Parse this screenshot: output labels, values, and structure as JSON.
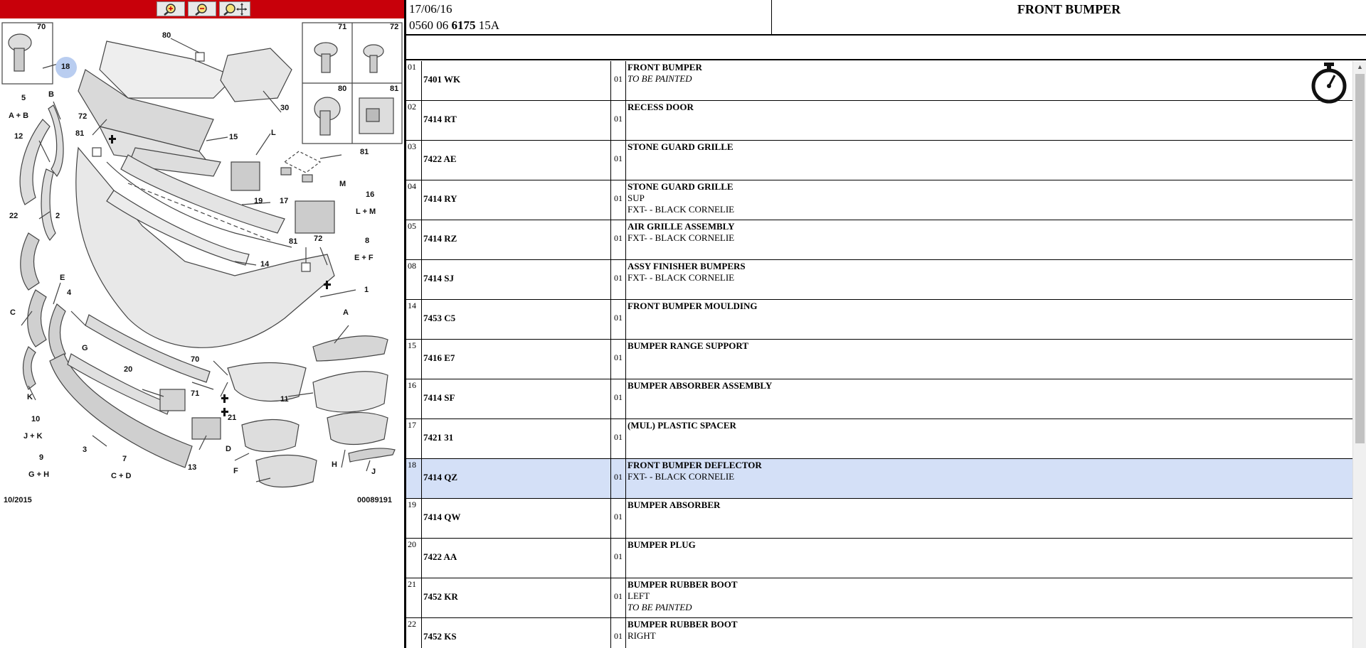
{
  "toolbar": {
    "buttons": [
      {
        "name": "zoom-in-button",
        "icon": "zoom-in-icon"
      },
      {
        "name": "zoom-out-button",
        "icon": "zoom-out-icon"
      },
      {
        "name": "zoom-pan-button",
        "icon": "zoom-pan-icon"
      }
    ],
    "color": "#c8000a"
  },
  "diagram": {
    "footer_left": "10/2015",
    "footer_right": "00089191",
    "highlight_label": "18",
    "callouts": [
      "70",
      "80",
      "30",
      "71",
      "72",
      "80",
      "81",
      "18",
      "5",
      "A + B",
      "B",
      "72",
      "81",
      "15",
      "L",
      "12",
      "81",
      "17",
      "M",
      "16",
      "L + M",
      "22",
      "2",
      "19",
      "14",
      "81",
      "72",
      "8",
      "E + F",
      "E",
      "1",
      "C",
      "4",
      "A",
      "G",
      "70",
      "20",
      "71",
      "11",
      "K",
      "21",
      "10",
      "J + K",
      "3",
      "D",
      "H",
      "9",
      "G + H",
      "7",
      "C + D",
      "13",
      "F",
      "J"
    ]
  },
  "header": {
    "date": "17/06/16",
    "code_a": "0560 06",
    "code_b": "6175",
    "code_c": "15A",
    "title": "FRONT BUMPER"
  },
  "rows": [
    {
      "idx": "01",
      "ref": "7401 WK",
      "qty": "01",
      "title": "FRONT BUMPER",
      "lines": [],
      "italic": "TO BE PAINTED"
    },
    {
      "idx": "02",
      "ref": "7414 RT",
      "qty": "01",
      "title": "RECESS DOOR",
      "lines": [],
      "italic": ""
    },
    {
      "idx": "03",
      "ref": "7422 AE",
      "qty": "01",
      "title": "STONE GUARD GRILLE",
      "lines": [],
      "italic": ""
    },
    {
      "idx": "04",
      "ref": "7414 RY",
      "qty": "01",
      "title": "STONE GUARD GRILLE",
      "lines": [
        "SUP",
        "FXT- - BLACK CORNELIE"
      ],
      "italic": ""
    },
    {
      "idx": "05",
      "ref": "7414 RZ",
      "qty": "01",
      "title": "AIR GRILLE ASSEMBLY",
      "lines": [
        "FXT- - BLACK CORNELIE"
      ],
      "italic": ""
    },
    {
      "idx": "08",
      "ref": "7414 SJ",
      "qty": "01",
      "title": "ASSY FINISHER BUMPERS",
      "lines": [
        "FXT- - BLACK CORNELIE"
      ],
      "italic": ""
    },
    {
      "idx": "14",
      "ref": "7453 C5",
      "qty": "01",
      "title": "FRONT BUMPER MOULDING",
      "lines": [],
      "italic": ""
    },
    {
      "idx": "15",
      "ref": "7416 E7",
      "qty": "01",
      "title": "BUMPER RANGE SUPPORT",
      "lines": [],
      "italic": ""
    },
    {
      "idx": "16",
      "ref": "7414 SF",
      "qty": "01",
      "title": "BUMPER ABSORBER ASSEMBLY",
      "lines": [],
      "italic": ""
    },
    {
      "idx": "17",
      "ref": "7421 31",
      "qty": "01",
      "title": "(MUL) PLASTIC SPACER",
      "lines": [],
      "italic": ""
    },
    {
      "idx": "18",
      "ref": "7414 QZ",
      "qty": "01",
      "title": "FRONT BUMPER DEFLECTOR",
      "lines": [
        "FXT- - BLACK CORNELIE"
      ],
      "italic": "",
      "selected": true
    },
    {
      "idx": "19",
      "ref": "7414 QW",
      "qty": "01",
      "title": "BUMPER ABSORBER",
      "lines": [],
      "italic": ""
    },
    {
      "idx": "20",
      "ref": "7422 AA",
      "qty": "01",
      "title": "BUMPER PLUG",
      "lines": [],
      "italic": ""
    },
    {
      "idx": "21",
      "ref": "7452 KR",
      "qty": "01",
      "title": "BUMPER RUBBER BOOT",
      "lines": [
        "LEFT"
      ],
      "italic": "TO BE PAINTED"
    },
    {
      "idx": "22",
      "ref": "7452 KS",
      "qty": "01",
      "title": "BUMPER RUBBER BOOT",
      "lines": [
        "RIGHT"
      ],
      "italic": ""
    }
  ],
  "colors": {
    "selected_row": "#d4e0f7",
    "highlight_circle": "#b9cdf0"
  },
  "icons": {
    "stopwatch": "stopwatch-icon",
    "scroll_up": "scroll-up-arrow-icon"
  }
}
